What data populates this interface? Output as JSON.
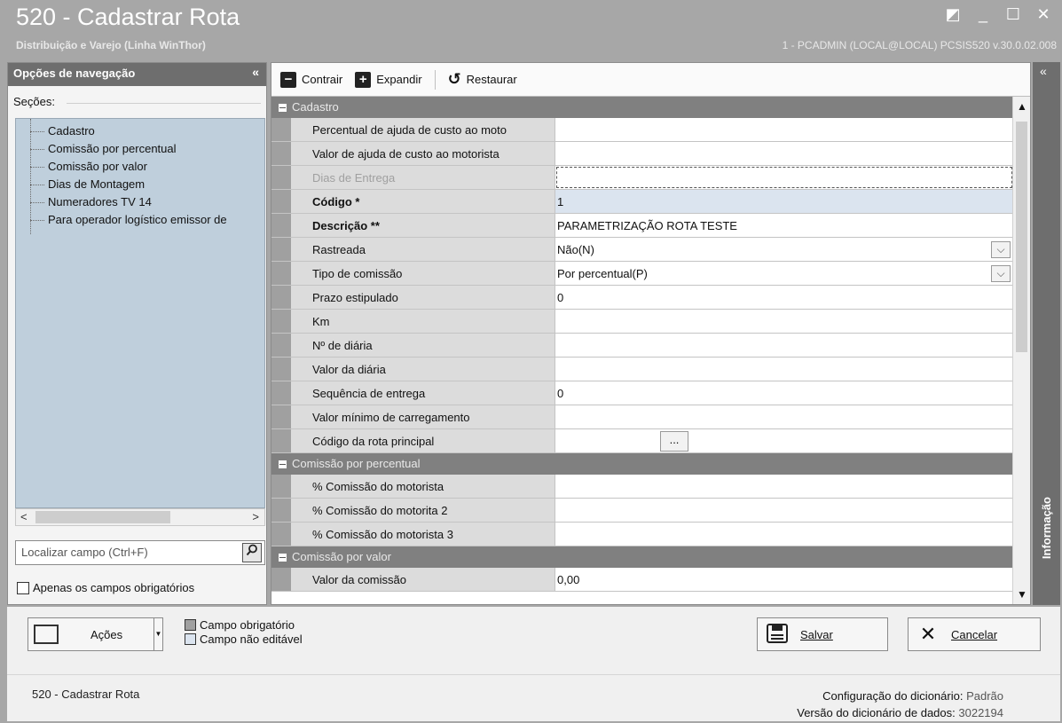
{
  "window": {
    "title": "520 - Cadastrar Rota",
    "subtitle": "Distribuição e Varejo (Linha WinThor)",
    "user_info": "1 - PCADMIN (LOCAL@LOCAL)   PCSIS520  v.30.0.02.008",
    "controls": {
      "restore": "◩",
      "minimize": "_",
      "maximize": "☐",
      "close": "✕"
    }
  },
  "nav": {
    "title": "Opções de navegação",
    "collapse": "«",
    "sections_label": "Seções:",
    "items": [
      "Cadastro",
      "Comissão por percentual",
      "Comissão por valor",
      "Dias de Montagem",
      "Numeradores TV 14",
      "Para operador logístico emissor de"
    ],
    "scroll_left": "<",
    "scroll_right": ">",
    "search_placeholder": "Localizar campo (Ctrl+F)",
    "search_icon": "magnifier-icon",
    "required_only": "Apenas os campos obrigatórios"
  },
  "toolbar": {
    "collapse": "Contrair",
    "expand": "Expandir",
    "restore": "Restaurar",
    "collapse_icon": "−",
    "expand_icon": "+",
    "restore_icon": "↺"
  },
  "grid": {
    "categories": {
      "cadastro": "Cadastro",
      "comissao_percentual": "Comissão por percentual",
      "comissao_valor": "Comissão por valor"
    },
    "cadastro_rows": [
      {
        "name": "Percentual de ajuda de custo ao moto",
        "value": ""
      },
      {
        "name": "Valor de ajuda de custo ao motorista",
        "value": ""
      },
      {
        "name": "Dias de Entrega",
        "value": ""
      },
      {
        "name": "Código *",
        "value": "1"
      },
      {
        "name": "Descrição **",
        "value": "PARAMETRIZAÇÃO ROTA TESTE"
      },
      {
        "name": "Rastreada",
        "value": "Não(N)"
      },
      {
        "name": "Tipo de comissão",
        "value": "Por percentual(P)"
      },
      {
        "name": "Prazo estipulado",
        "value": "0"
      },
      {
        "name": "Km",
        "value": ""
      },
      {
        "name": "Nº de diária",
        "value": ""
      },
      {
        "name": "Valor da diária",
        "value": ""
      },
      {
        "name": "Sequência de entrega",
        "value": "0"
      },
      {
        "name": "Valor mínimo de carregamento",
        "value": ""
      },
      {
        "name": "Código da rota principal",
        "value": "",
        "button": "..."
      }
    ],
    "percentual_rows": [
      {
        "name": "% Comissão do motorista",
        "value": ""
      },
      {
        "name": "% Comissão do motorita 2",
        "value": ""
      },
      {
        "name": "% Comissão do motorista 3",
        "value": ""
      }
    ],
    "valor_rows": [
      {
        "name": "Valor da comissão",
        "value": "0,00"
      }
    ],
    "dropdown_icon": "⌵"
  },
  "info_panel": {
    "label": "Informação",
    "collapse": "«"
  },
  "bottom": {
    "actions_label": "Ações",
    "legend_required": "Campo obrigatório",
    "legend_readonly": "Campo não editável",
    "save_label": "Salvar",
    "cancel_label": "Cancelar",
    "save_icon": "🖫",
    "cancel_icon": "✕"
  },
  "status": {
    "left": "520 - Cadastrar Rota",
    "dict_config_label": "Configuração do dicionário:",
    "dict_config_value": "Padrão",
    "dict_version_label": "Versão do dicionário de dados:",
    "dict_version_value": "3022194"
  },
  "colors": {
    "titlebar": "#a7a7a7",
    "category_header": "#808080",
    "tree_background": "#bfcfdc",
    "property_name": "#dcdcdc"
  }
}
